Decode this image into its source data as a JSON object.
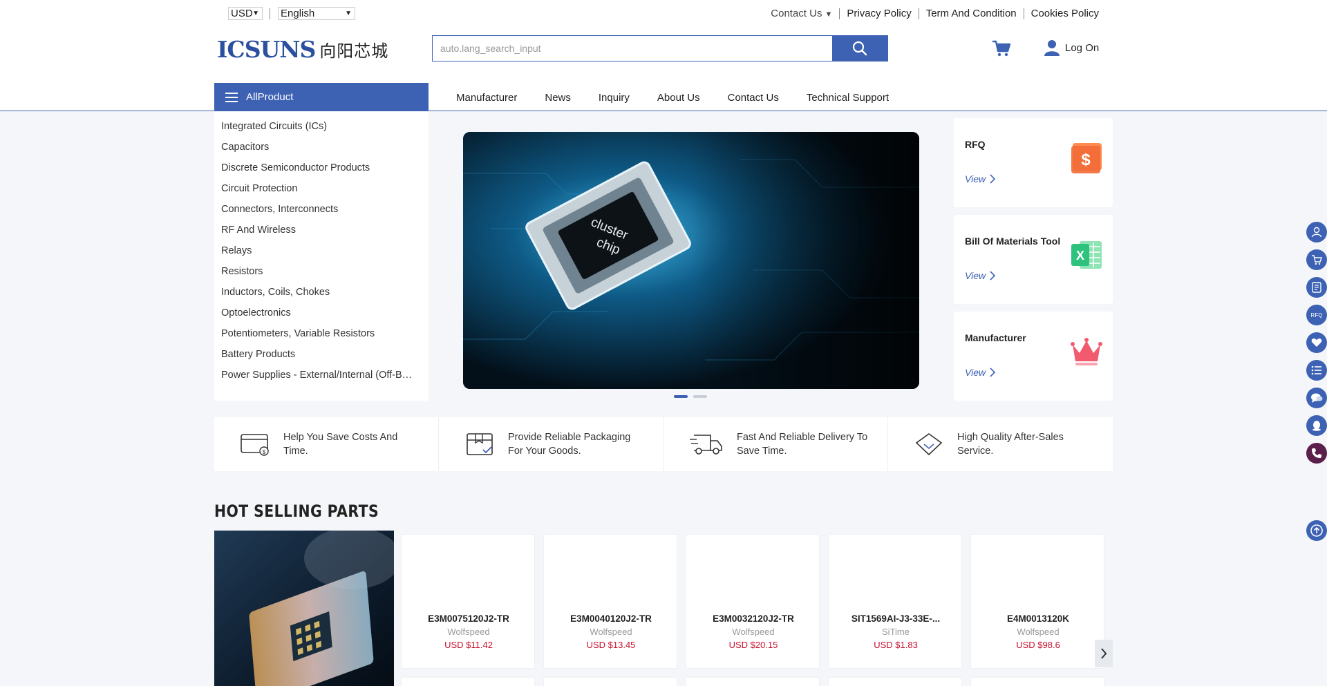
{
  "topbar": {
    "currency": "USD",
    "language": "English",
    "links": [
      "Contact Us",
      "Privacy Policy",
      "Term And Condition",
      "Cookies Policy"
    ]
  },
  "logo": {
    "en": "ICSUNS",
    "cn": "向阳芯城"
  },
  "search": {
    "placeholder": "auto.lang_search_input"
  },
  "account": {
    "logon": "Log On"
  },
  "nav": {
    "all_product": "AllProduct",
    "items": [
      "Manufacturer",
      "News",
      "Inquiry",
      "About Us",
      "Contact Us",
      "Technical Support"
    ]
  },
  "categories": [
    "Integrated Circuits (ICs)",
    "Capacitors",
    "Discrete Semiconductor Products",
    "Circuit Protection",
    "Connectors, Interconnects",
    "RF And Wireless",
    "Relays",
    "Resistors",
    "Inductors, Coils, Chokes",
    "Optoelectronics",
    "Potentiometers, Variable Resistors",
    "Battery Products",
    "Power Supplies - External/Internal (Off-Board)"
  ],
  "banner": {
    "chip_line1": "cluster",
    "chip_line2": "chip"
  },
  "cards": [
    {
      "title": "RFQ",
      "view": "View"
    },
    {
      "title": "Bill Of Materials Tool",
      "view": "View"
    },
    {
      "title": "Manufacturer",
      "view": "View"
    }
  ],
  "features": [
    "Help You Save Costs And Time.",
    "Provide Reliable Packaging For Your Goods.",
    "Fast And Reliable Delivery To Save Time.",
    "High Quality After-Sales Service."
  ],
  "hot": {
    "title": "HOT SELLING PARTS",
    "products": [
      {
        "part": "E3M0075120J2-TR",
        "maker": "Wolfspeed",
        "price": "USD $11.42"
      },
      {
        "part": "E3M0040120J2-TR",
        "maker": "Wolfspeed",
        "price": "USD $13.45"
      },
      {
        "part": "E3M0032120J2-TR",
        "maker": "Wolfspeed",
        "price": "USD $20.15"
      },
      {
        "part": "SIT1569AI-J3-33E-...",
        "maker": "SiTime",
        "price": "USD $1.83"
      },
      {
        "part": "E4M0013120K",
        "maker": "Wolfspeed",
        "price": "USD $98.6"
      }
    ]
  },
  "floaters": {
    "rfq_label": "RFQ"
  },
  "colors": {
    "brand": "#3d62b4",
    "price": "#c8102e"
  }
}
